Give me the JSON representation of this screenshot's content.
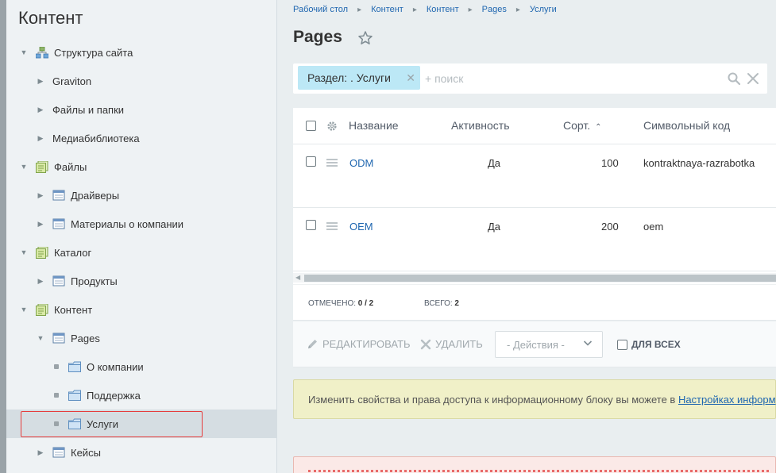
{
  "sidebar": {
    "title": "Контент",
    "items": [
      {
        "label": "Структура сайта",
        "icon": "site-structure-icon",
        "expanded": true
      },
      {
        "label": "Graviton",
        "icon": "",
        "expanded": false
      },
      {
        "label": "Файлы и папки",
        "icon": "",
        "expanded": false
      },
      {
        "label": "Медиабиблиотека",
        "icon": "",
        "expanded": false
      },
      {
        "label": "Файлы",
        "icon": "iblock-type-icon",
        "expanded": true
      },
      {
        "label": "Драйверы",
        "icon": "iblock-icon",
        "expanded": false
      },
      {
        "label": "Материалы о компании",
        "icon": "iblock-icon",
        "expanded": false
      },
      {
        "label": "Каталог",
        "icon": "iblock-type-icon",
        "expanded": true
      },
      {
        "label": "Продукты",
        "icon": "iblock-icon",
        "expanded": false
      },
      {
        "label": "Контент",
        "icon": "iblock-type-icon",
        "expanded": true
      },
      {
        "label": "Pages",
        "icon": "iblock-icon",
        "expanded": true
      },
      {
        "label": "О компании",
        "icon": "folder-icon",
        "expanded": false
      },
      {
        "label": "Поддержка",
        "icon": "folder-icon",
        "expanded": false
      },
      {
        "label": "Услуги",
        "icon": "folder-icon",
        "selected": true
      },
      {
        "label": "Кейсы",
        "icon": "iblock-icon",
        "expanded": false
      }
    ]
  },
  "breadcrumb": [
    "Рабочий стол",
    "Контент",
    "Контент",
    "Pages",
    "Услуги"
  ],
  "page": {
    "title": "Pages"
  },
  "search": {
    "chip": "Раздел: . Услуги",
    "placeholder": "+ поиск"
  },
  "grid": {
    "columns": [
      "Название",
      "Активность",
      "Сорт.",
      "Символьный код"
    ],
    "rows": [
      {
        "name": "ODM",
        "active": "Да",
        "sort": "100",
        "code": "kontraktnaya-razrabotka"
      },
      {
        "name": "OEM",
        "active": "Да",
        "sort": "200",
        "code": "oem"
      }
    ]
  },
  "footer": {
    "checked_label": "Отмечено:",
    "checked_value": "0 / 2",
    "total_label": "Всего:",
    "total_value": "2"
  },
  "actions": {
    "edit": "Редактировать",
    "delete": "Удалить",
    "select": "- Действия -",
    "for_all": "Для всех"
  },
  "notice": {
    "text": "Изменить свойства и права доступа к информационному блоку вы можете в ",
    "link": "Настройках информ"
  },
  "colors": {
    "link": "#2067b0",
    "chip": "#bce8f6",
    "selection_border": "#e63c3c",
    "notice_bg": "#f0f0c8"
  }
}
